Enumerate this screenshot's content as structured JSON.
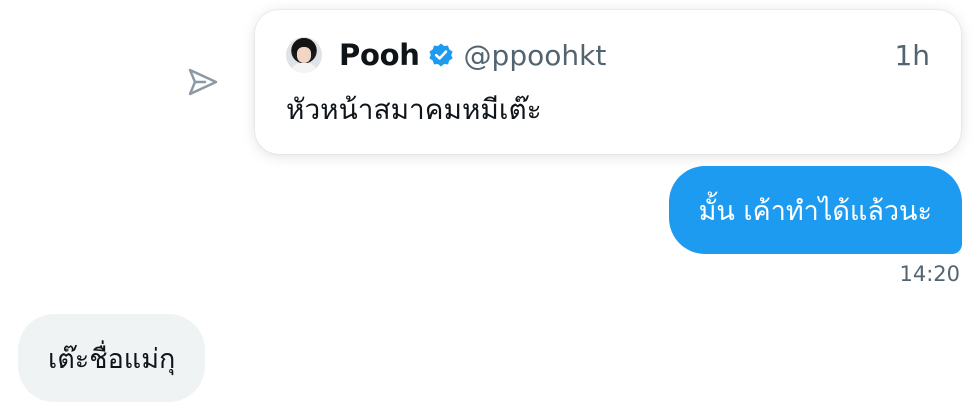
{
  "conversation": {
    "share_icon": "share-icon",
    "quoted_tweet": {
      "avatar_icon": "avatar",
      "display_name": "Pooh",
      "verified_icon": "verified-badge-icon",
      "handle": "@ppoohkt",
      "time": "1h",
      "text": "หัวหน้าสมาคมหมีเต๊ะ"
    },
    "sent_message": {
      "text": "มั้น เค้าทำได้แล้วนะ",
      "time": "14:20"
    },
    "received_message": {
      "text": "เต๊ะชื่อแม่กุ"
    }
  },
  "colors": {
    "accent": "#1d9bf0",
    "received_bubble": "#eff3f4",
    "secondary_text": "#536471",
    "primary_text": "#0f1419"
  }
}
